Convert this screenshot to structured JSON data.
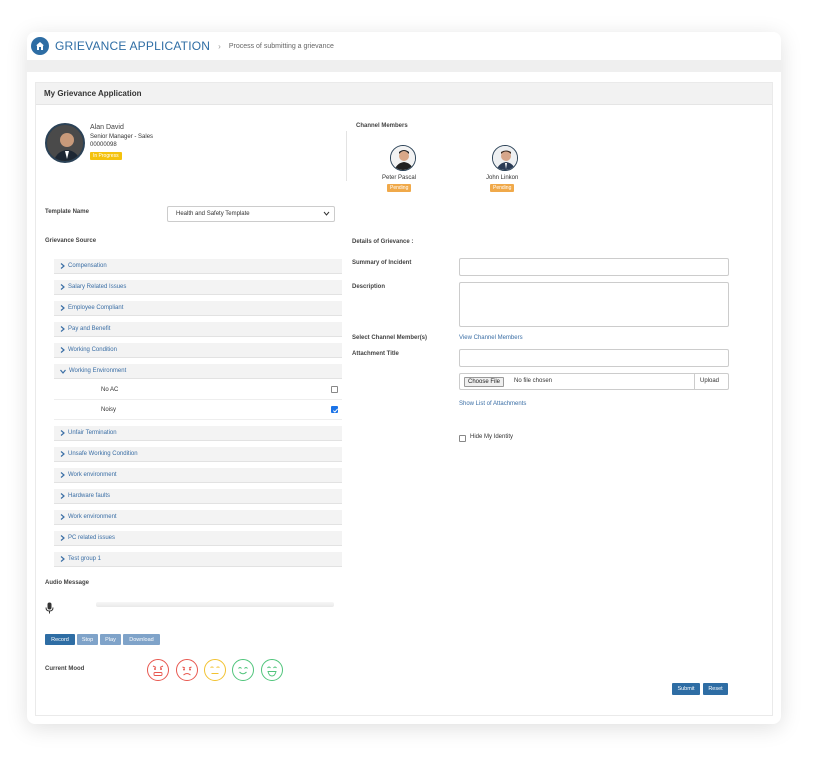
{
  "header": {
    "app_title": "GRIEVANCE APPLICATION",
    "separator": "›",
    "subtitle": "Process of submitting a grievance"
  },
  "panel": {
    "title": "My Grievance Application"
  },
  "employee": {
    "name": "Alan David",
    "designation": "Senior Manager - Sales",
    "id": "00000098",
    "status": "In Progress"
  },
  "channel": {
    "heading": "Channel Members",
    "members": [
      {
        "name": "Peter Pascal",
        "status": "Pending"
      },
      {
        "name": "John Linkon",
        "status": "Pending"
      }
    ]
  },
  "template": {
    "label": "Template Name",
    "value": "Health and Safety Template"
  },
  "source": {
    "label": "Grievance Source",
    "groups_before": [
      "Compensation",
      "Salary Related Issues",
      "Employee Compliant",
      "Pay and Benefit",
      "Working Condition"
    ],
    "expanded": {
      "label": "Working Environment",
      "items": [
        {
          "label": "No AC",
          "checked": false
        },
        {
          "label": "Noisy",
          "checked": true
        }
      ]
    },
    "groups_after": [
      "Unfair Termination",
      "Unsafe Working Condition",
      "Work environment",
      "Hardware faults",
      "Work environment",
      "PC related issues",
      "Test group 1"
    ]
  },
  "audio": {
    "label": "Audio Message",
    "buttons": [
      "Record",
      "Stop",
      "Play",
      "Download"
    ]
  },
  "mood": {
    "label": "Current Mood",
    "colors": [
      "#e8574f",
      "#e8574f",
      "#f2c230",
      "#4fc47a",
      "#4fc47a"
    ]
  },
  "details": {
    "heading": "Details of Grievance :",
    "summary_label": "Summary of Incident",
    "description_label": "Description",
    "select_members_label": "Select Channel Member(s)",
    "view_members_link": "View Channel Members",
    "attachment_label": "Attachment Title",
    "choose_file": "Choose File",
    "no_file": "No file chosen",
    "upload": "Upload",
    "show_attachments": "Show List of Attachments",
    "hide_identity": "Hide My Identity"
  },
  "actions": {
    "submit": "Submit",
    "reset": "Reset"
  },
  "colors": {
    "accent": "#2e6da4",
    "link": "#3a6ea5",
    "pending": "#f0a94a",
    "in_progress": "#f4c20d"
  }
}
